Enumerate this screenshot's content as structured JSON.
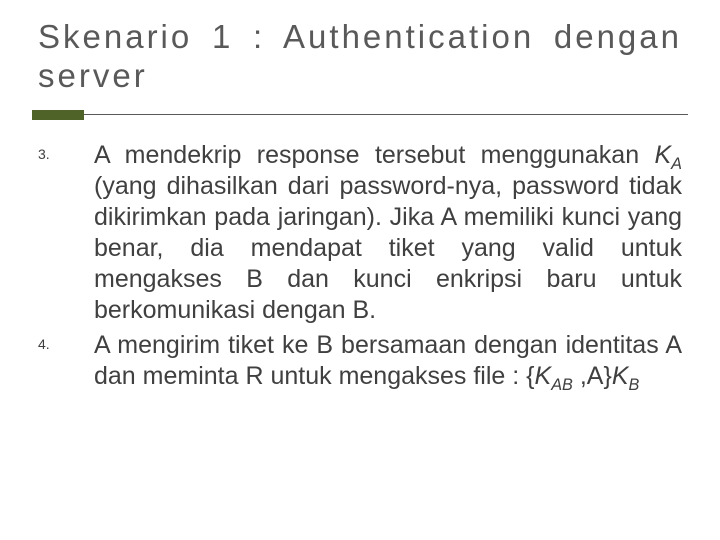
{
  "title": "Skenario 1 : Authentication dengan server",
  "items": [
    {
      "html": "A mendekrip response tersebut menggunakan <span class=\"ital\">K<sub>A</sub></span> (yang dihasilkan dari password-nya, password tidak dikirimkan pada jaringan). Jika A memiliki kunci yang benar, dia mendapat tiket yang valid untuk mengakses B dan kunci enkripsi baru untuk berkomunikasi dengan B."
    },
    {
      "html": "A mengirim tiket ke B bersamaan dengan identitas A dan meminta R untuk mengakses file : {<span class=\"ital\">K<sub>AB</sub></span> ,A}<span class=\"ital\">K<sub>B</sub></span>"
    }
  ]
}
